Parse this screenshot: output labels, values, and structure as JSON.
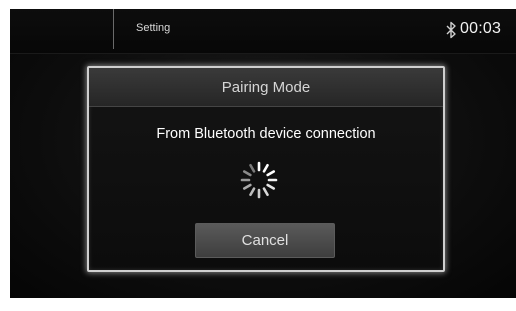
{
  "topbar": {
    "title": "Setting",
    "clock": "00:03",
    "bluetooth_icon": "bluetooth-icon"
  },
  "dialog": {
    "title": "Pairing Mode",
    "message": "From Bluetooth device connection",
    "spinner_icon": "loading-spinner-icon",
    "cancel_label": "Cancel"
  },
  "colors": {
    "background": "#0e0e0e",
    "dialog_border": "#cfcfcf",
    "button": "#4a4a4a"
  }
}
